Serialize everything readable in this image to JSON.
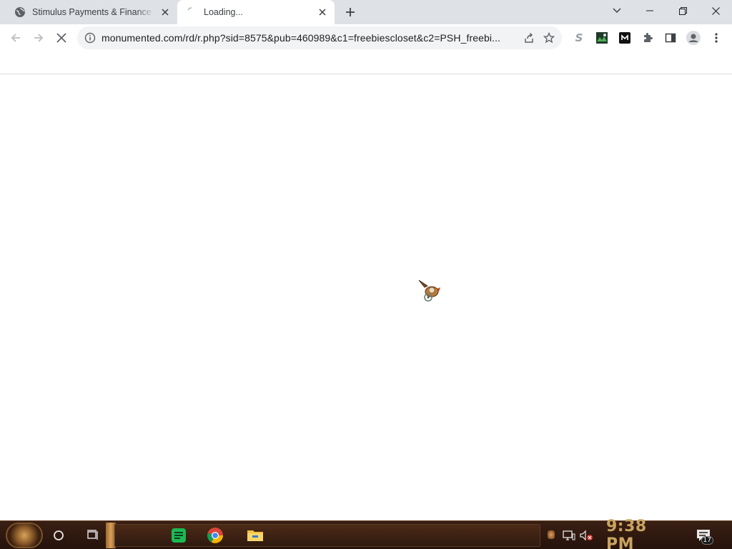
{
  "browser": {
    "tabs": [
      {
        "title": "Stimulus Payments & Finance O",
        "active": false,
        "favicon": "globe-icon"
      },
      {
        "title": "Loading...",
        "active": true,
        "favicon": "loading-spinner-icon"
      }
    ],
    "new_tab_label": "+",
    "url": "monumented.com/rd/r.php?sid=8575&pub=460989&c1=freebiescloset&c2=PSH_freebi...",
    "extensions": [
      "s-extension-icon",
      "image-extension-icon",
      "m-extension-icon",
      "puzzle-extensions-icon"
    ]
  },
  "page": {
    "cursor_icon": "steampunk-cursor-icon"
  },
  "taskbar": {
    "clock": "9:38 PM",
    "notification_count": "17",
    "apps": [
      "notes-app-icon",
      "chrome-icon",
      "file-explorer-icon"
    ]
  },
  "colors": {
    "tabstrip_bg": "#dee1e6",
    "omnibox_bg": "#f1f3f4",
    "clock_color": "#c8a460",
    "taskbar_bg": "#2e1a10"
  }
}
